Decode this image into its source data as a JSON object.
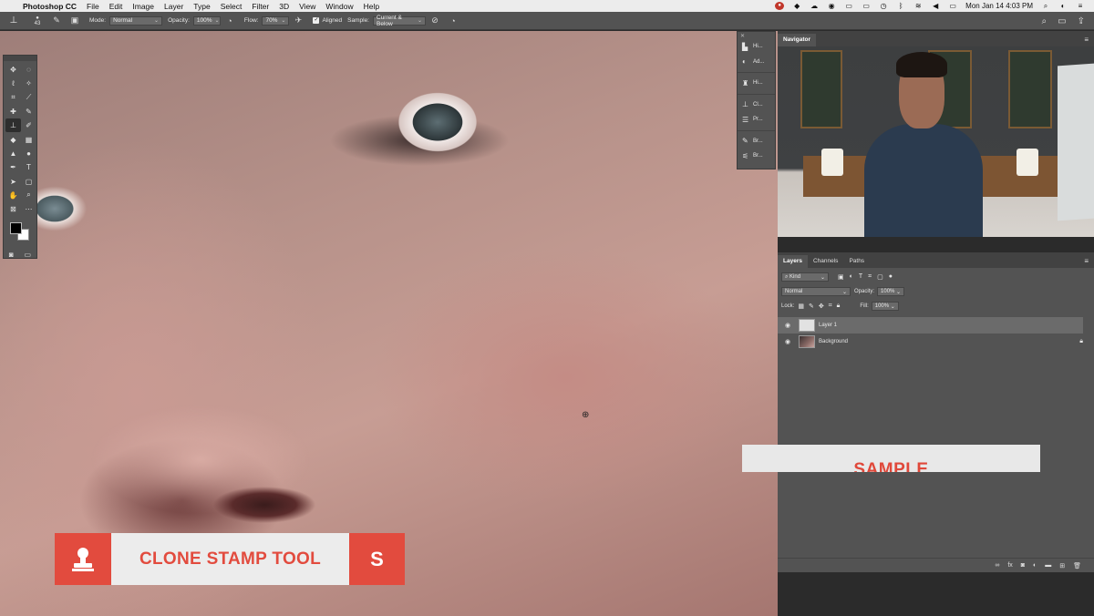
{
  "menubar": {
    "app_name": "Photoshop CC",
    "items": [
      "File",
      "Edit",
      "Image",
      "Layer",
      "Type",
      "Select",
      "Filter",
      "3D",
      "View",
      "Window",
      "Help"
    ],
    "clock": "Mon Jan 14  4:03 PM"
  },
  "options_bar": {
    "brush_size": "43",
    "mode_label": "Mode:",
    "mode_value": "Normal",
    "opacity_label": "Opacity:",
    "opacity_value": "100%",
    "flow_label": "Flow:",
    "flow_value": "70%",
    "aligned_label": "Aligned",
    "sample_label": "Sample:",
    "sample_value": "Current & Below"
  },
  "strip": {
    "items": [
      "Hi...",
      "Ad...",
      "Hi...",
      "Cl...",
      "Pr...",
      "Br...",
      "Br..."
    ]
  },
  "navigator": {
    "tab": "Navigator"
  },
  "layers_panel": {
    "tabs": [
      "Layers",
      "Channels",
      "Paths"
    ],
    "kind_label": "Kind",
    "blend_mode": "Normal",
    "opacity_label": "Opacity:",
    "opacity_value": "100%",
    "lock_label": "Lock:",
    "fill_label": "Fill:",
    "fill_value": "100%",
    "layers": [
      {
        "name": "Layer 1",
        "selected": true
      },
      {
        "name": "Background",
        "selected": false
      }
    ]
  },
  "watermark": {
    "text": "SAMPLE"
  },
  "lower_third": {
    "title": "CLONE STAMP TOOL",
    "shortcut_key": "S"
  },
  "colors": {
    "accent": "#e24b3e",
    "panel": "#535353",
    "foreground_swatch": "#000000",
    "background_swatch": "#ffffff"
  }
}
